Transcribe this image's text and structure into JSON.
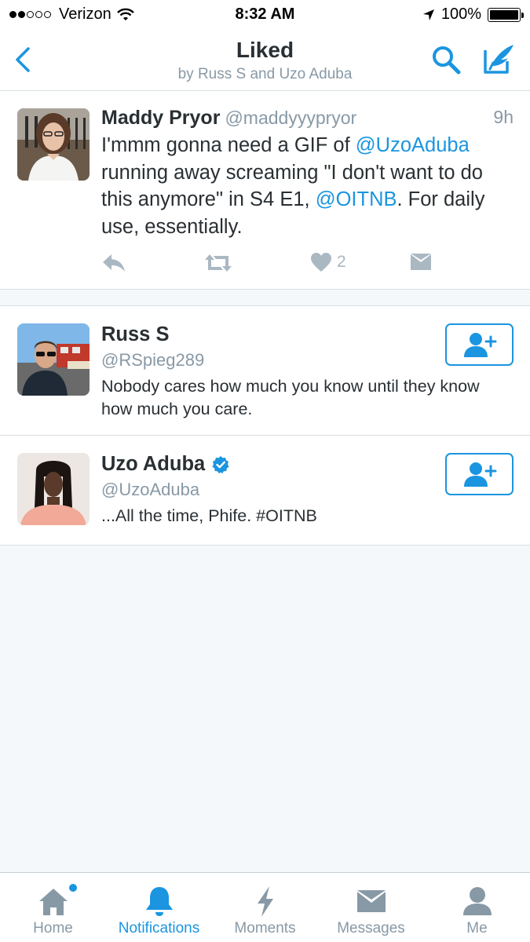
{
  "status_bar": {
    "carrier": "Verizon",
    "time": "8:32 AM",
    "battery": "100%"
  },
  "nav": {
    "title": "Liked",
    "subtitle": "by Russ S and Uzo Aduba"
  },
  "tweet": {
    "name": "Maddy Pryor",
    "handle": "@maddyyypryor",
    "time": "9h",
    "text_parts": [
      "I'mmm gonna need a GIF of ",
      "@UzoAduba",
      " running away screaming \"I don't want to do this anymore\" in S4 E1, ",
      "@OITNB",
      ". For daily use, essentially."
    ],
    "like_count": "2"
  },
  "users": [
    {
      "name": "Russ S",
      "handle": "@RSpieg289",
      "bio": "Nobody cares how much you know until they know how much you care.",
      "verified": false
    },
    {
      "name": "Uzo Aduba",
      "handle": "@UzoAduba",
      "bio": "...All the time, Phife. #OITNB",
      "verified": true
    }
  ],
  "tabs": [
    {
      "label": "Home",
      "icon": "home-icon",
      "active": false
    },
    {
      "label": "Notifications",
      "icon": "bell-icon",
      "active": true
    },
    {
      "label": "Moments",
      "icon": "lightning-icon",
      "active": false
    },
    {
      "label": "Messages",
      "icon": "envelope-icon",
      "active": false
    },
    {
      "label": "Me",
      "icon": "person-icon",
      "active": false
    }
  ],
  "colors": {
    "accent": "#1b95e0",
    "muted": "#8899a6",
    "background": "#f5f8fa"
  }
}
